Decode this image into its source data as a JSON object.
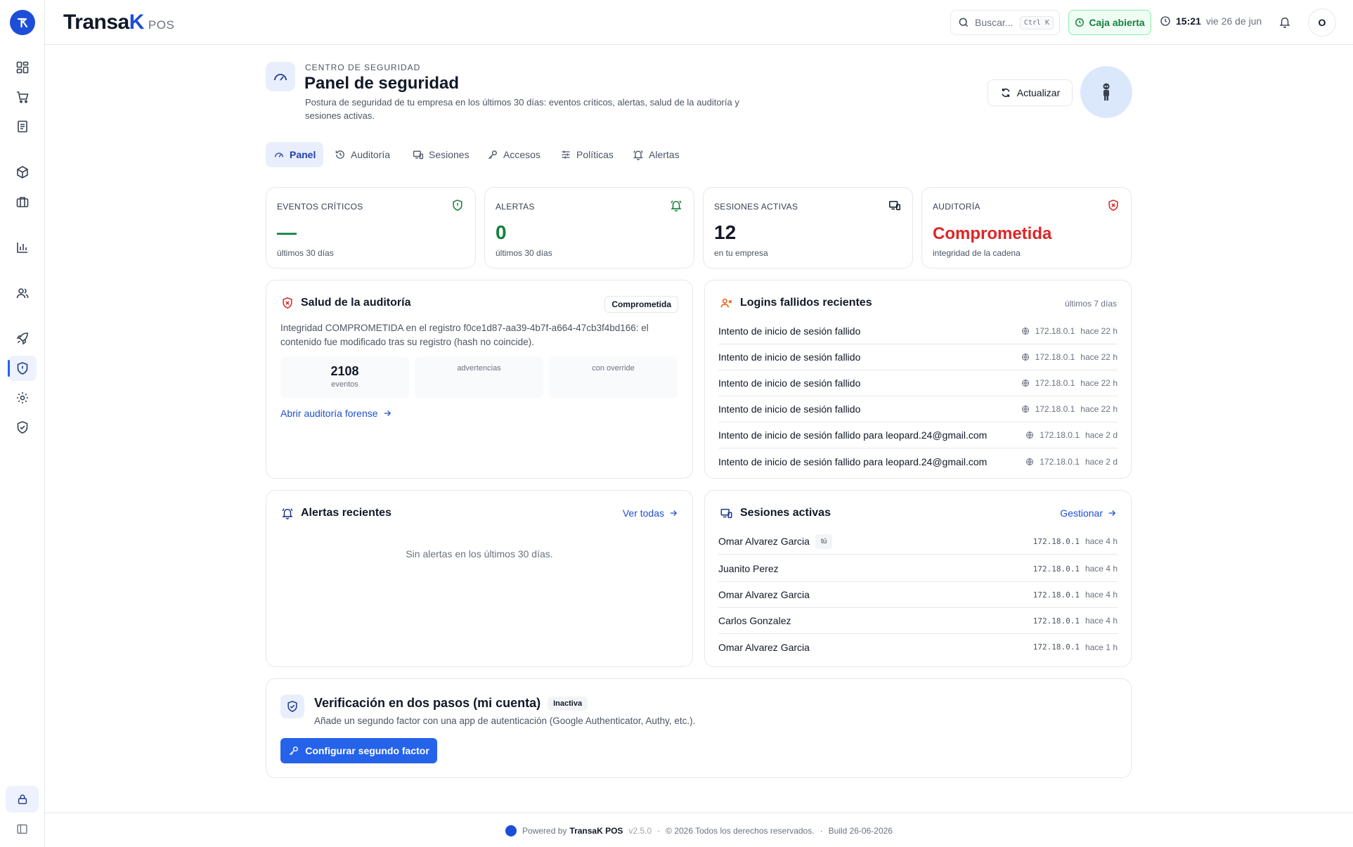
{
  "app": {
    "brand_main": "Transa",
    "brand_k": "K",
    "brand_pos": "POS"
  },
  "topbar": {
    "search_placeholder": "Buscar...",
    "search_shortcut": "Ctrl K",
    "cash_status": "Caja abierta",
    "time": "15:21",
    "date": "vie 26 de jun",
    "user_initial": "O"
  },
  "rail": {
    "icons": [
      "dashboard-icon",
      "cart-icon",
      "receipt-icon",
      "package-icon",
      "briefcase-icon",
      "chart-icon",
      "users-icon",
      "rocket-icon",
      "shield-icon",
      "gear-icon",
      "shield-check-icon",
      "lock-icon",
      "sidebar-toggle-icon"
    ],
    "active": "shield-icon"
  },
  "header": {
    "eyebrow": "CENTRO DE SEGURIDAD",
    "title": "Panel de seguridad",
    "description_line1": "Postura de seguridad de tu empresa en los últimos 30 días: eventos críticos, alertas, salud de la auditoría y",
    "description_line2": "sesiones activas.",
    "refresh_label": "Actualizar"
  },
  "tabs": [
    {
      "label": "Panel",
      "icon": "gauge-icon",
      "active": true
    },
    {
      "label": "Auditoría",
      "icon": "history-icon"
    },
    {
      "label": "Sesiones",
      "icon": "devices-icon"
    },
    {
      "label": "Accesos",
      "icon": "key-icon"
    },
    {
      "label": "Políticas",
      "icon": "sliders-icon"
    },
    {
      "label": "Alertas",
      "icon": "bell-ring-icon"
    }
  ],
  "kpis": [
    {
      "label": "EVENTOS CRÍTICOS",
      "value": "—",
      "sub": "últimos 30 días",
      "color": "#15803d"
    },
    {
      "label": "ALERTAS",
      "value": "0",
      "sub": "últimos 30 días",
      "color": "#15803d"
    },
    {
      "label": "SESIONES ACTIVAS",
      "value": "12",
      "sub": "en tu empresa",
      "color": "#111827"
    },
    {
      "label": "AUDITORÍA",
      "value": "Comprometida",
      "sub": "integridad de la cadena",
      "color": "#dc2626"
    }
  ],
  "audit": {
    "title": "Salud de la auditoría",
    "badge": "Comprometida",
    "message_line1": "Integridad COMPROMETIDA en el registro f0ce1d87-aa39-4b7f-a664-47cb3f4bd166: el",
    "message_line2": "contenido fue modificado tras su registro (hash no coincide).",
    "stats": [
      {
        "value": "2108",
        "label": "eventos"
      },
      {
        "value": "",
        "label": "advertencias"
      },
      {
        "value": "",
        "label": "con override"
      }
    ],
    "link": "Abrir auditoría forense"
  },
  "failed_logins": {
    "title": "Logins fallidos recientes",
    "range": "últimos 7 días",
    "rows": [
      {
        "text": "Intento de inicio de sesión fallido",
        "ip": "172.18.0.1",
        "ago": "hace 22 h"
      },
      {
        "text": "Intento de inicio de sesión fallido",
        "ip": "172.18.0.1",
        "ago": "hace 22 h"
      },
      {
        "text": "Intento de inicio de sesión fallido",
        "ip": "172.18.0.1",
        "ago": "hace 22 h"
      },
      {
        "text": "Intento de inicio de sesión fallido",
        "ip": "172.18.0.1",
        "ago": "hace 22 h"
      },
      {
        "text": "Intento de inicio de sesión fallido para leopard.24@gmail.com",
        "ip": "172.18.0.1",
        "ago": "hace 2 d"
      },
      {
        "text": "Intento de inicio de sesión fallido para leopard.24@gmail.com",
        "ip": "172.18.0.1",
        "ago": "hace 2 d"
      }
    ]
  },
  "alerts": {
    "title": "Alertas recientes",
    "link": "Ver todas",
    "empty": "Sin alertas en los últimos 30 días."
  },
  "sessions": {
    "title": "Sesiones activas",
    "link": "Gestionar",
    "rows": [
      {
        "name": "Omar Alvarez Garcia",
        "tag": "tú",
        "ip": "172.18.0.1",
        "ago": "hace 4 h"
      },
      {
        "name": "Juanito Perez",
        "tag": "",
        "ip": "172.18.0.1",
        "ago": "hace 4 h"
      },
      {
        "name": "Omar Alvarez Garcia",
        "tag": "",
        "ip": "172.18.0.1",
        "ago": "hace 4 h"
      },
      {
        "name": "Carlos Gonzalez",
        "tag": "",
        "ip": "172.18.0.1",
        "ago": "hace 4 h"
      },
      {
        "name": "Omar Alvarez Garcia",
        "tag": "",
        "ip": "172.18.0.1",
        "ago": "hace 1 h"
      }
    ]
  },
  "twofa": {
    "title": "Verificación en dos pasos (mi cuenta)",
    "badge": "Inactiva",
    "description": "Añade un segundo factor con una app de autenticación (Google Authenticator, Authy, etc.).",
    "button": "Configurar segundo factor"
  },
  "footer": {
    "powered": "Powered by",
    "brand": "TransaK POS",
    "version": "v2.5.0",
    "sep": "·",
    "copyright": "© 2026 Todos los derechos reservados.",
    "build": "Build 26-06-2026"
  },
  "colors": {
    "accent": "#2563eb",
    "danger": "#dc2626",
    "success": "#15803d"
  }
}
